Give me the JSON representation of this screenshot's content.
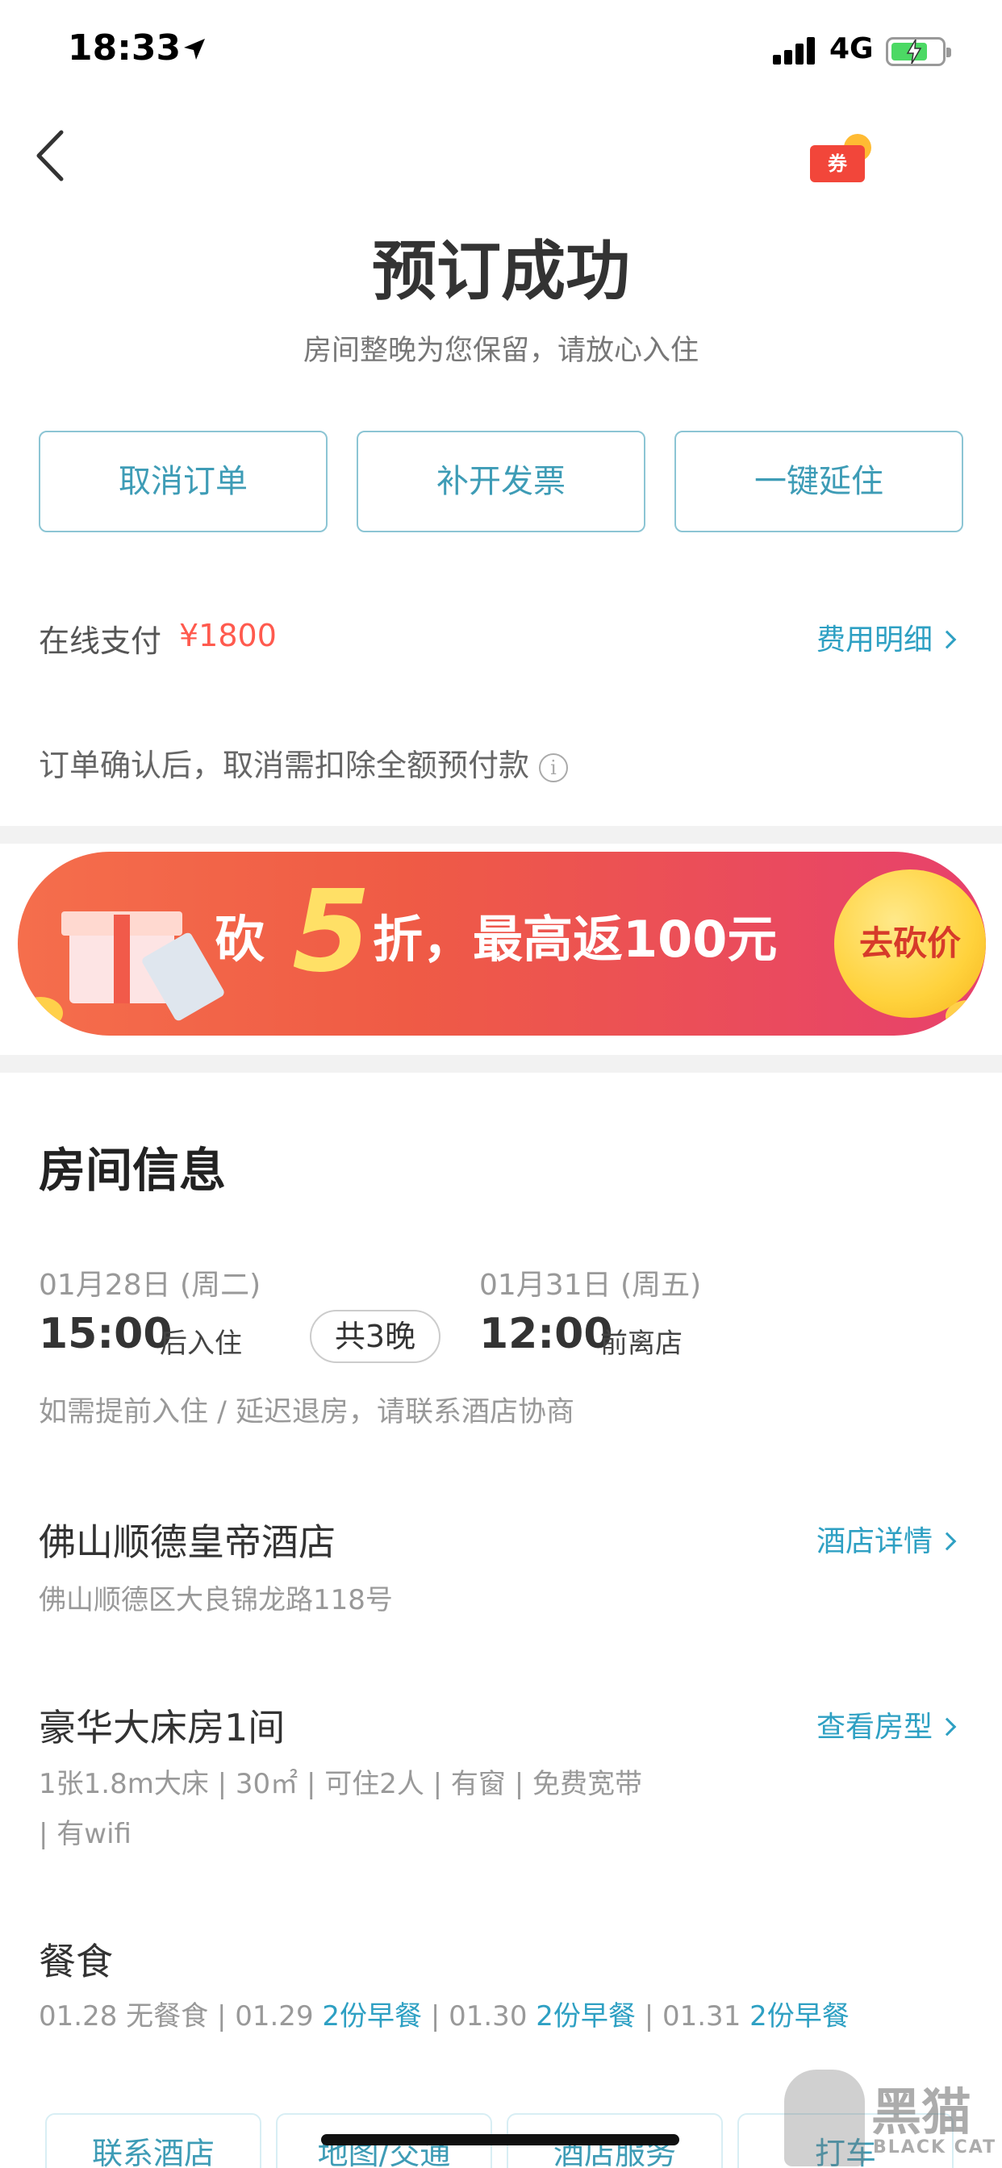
{
  "status_bar": {
    "time": "18:33",
    "network": "4G"
  },
  "header": {
    "title": "预订成功",
    "subtitle": "房间整晚为您保留，请放心入住",
    "coupon_label": "券"
  },
  "actions": [
    {
      "label": "取消订单"
    },
    {
      "label": "补开发票"
    },
    {
      "label": "一键延住"
    }
  ],
  "payment": {
    "label": "在线支付",
    "amount": "¥1800",
    "detail_link": "费用明细",
    "cancel_note": "订单确认后，取消需扣除全额预付款",
    "info_icon": "i"
  },
  "promo": {
    "text_before": "砍",
    "highlight": "5",
    "text_after": "折，最高返100元",
    "button": "去砍价"
  },
  "room_info": {
    "title": "房间信息",
    "checkin_date": "01月28日 (周二)",
    "checkin_time": "15:00",
    "checkin_suffix": "后入住",
    "nights": "共3晚",
    "checkout_date": "01月31日 (周五)",
    "checkout_time": "12:00",
    "checkout_suffix": "前离店",
    "note": "如需提前入住 / 延迟退房，请联系酒店协商"
  },
  "hotel": {
    "name": "佛山顺德皇帝酒店",
    "address": "佛山顺德区大良锦龙路118号",
    "detail_link": "酒店详情"
  },
  "room": {
    "name": "豪华大床房1间",
    "features_line1": "1张1.8m大床 | 30㎡ | 可住2人 | 有窗 | 免费宽带",
    "features_line2": "| 有wifi",
    "detail_link": "查看房型"
  },
  "meals": {
    "title": "餐食",
    "items": [
      {
        "date": "01.28",
        "value": "无餐食",
        "highlight": false
      },
      {
        "date": "01.29",
        "value": "2份早餐",
        "highlight": true
      },
      {
        "date": "01.30",
        "value": "2份早餐",
        "highlight": true
      },
      {
        "date": "01.31",
        "value": "2份早餐",
        "highlight": true
      }
    ]
  },
  "bottom_actions": [
    {
      "label": "联系酒店"
    },
    {
      "label": "地图/交通"
    },
    {
      "label": "酒店服务"
    },
    {
      "label": "打车"
    }
  ],
  "watermark": {
    "cn": "黑猫",
    "en": "BLACK CAT"
  },
  "colors": {
    "accent": "#2ea0c3",
    "price": "#ff5a4e",
    "button_border": "#8cc5d4"
  }
}
